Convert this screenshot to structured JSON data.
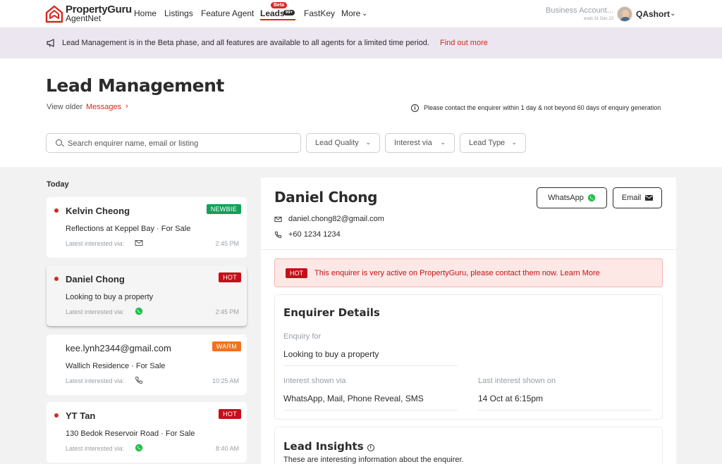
{
  "brand": {
    "name": "PropertyGuru",
    "sub": "AgentNet",
    "color": "#d6281e"
  },
  "nav": {
    "home": "Home",
    "listings": "Listings",
    "feature_agent": "Feature Agent",
    "leads": "Leads",
    "leads_beta": "Beta",
    "leads_count": "99+",
    "fastkey": "FastKey",
    "more": "More"
  },
  "account": {
    "business": "Business Account...",
    "expiry": "ends 31 Dec 23",
    "user": "QAshort"
  },
  "banner": {
    "text": "Lead Management is in the Beta phase, and all features are available to all agents for a limited time period.",
    "link": "Find out more"
  },
  "page": {
    "title": "Lead Management",
    "view_older": "View older",
    "messages_link": "Messages",
    "notice": "Please contact the enquirer within 1 day & not beyond 60 days of enquiry generation"
  },
  "filters": {
    "search_placeholder": "Search enquirer name, email or listing",
    "lead_quality": "Lead Quality",
    "interest_via": "Interest via",
    "lead_type": "Lead Type"
  },
  "list": {
    "group": "Today",
    "via_label": "Latest interested via:",
    "leads": [
      {
        "name": "Kelvin Cheong",
        "badge": "NEWBIE",
        "sub": "Reflections at Keppel Bay  ·  For Sale",
        "via": "mail-icon",
        "time": "2:45 PM",
        "unread": true
      },
      {
        "name": "Daniel Chong",
        "badge": "HOT",
        "sub": "Looking to  buy a property",
        "via": "whatsapp-icon",
        "time": "2:45 PM",
        "unread": true
      },
      {
        "name": "kee.lynh2344@gmail.com",
        "badge": "WARM",
        "sub": "Wallich Residence  ·  For Sale",
        "via": "phone-icon",
        "time": "10:25 AM",
        "unread": false
      },
      {
        "name": "YT Tan",
        "badge": "HOT",
        "sub": "130 Bedok Reservoir Road  ·  For Sale",
        "via": "whatsapp-icon",
        "time": "8:40 AM",
        "unread": true
      }
    ]
  },
  "detail": {
    "name": "Daniel Chong",
    "whatsapp_label": "WhatsApp",
    "email_label": "Email",
    "email": "daniel.chong82@gmail.com",
    "phone": "+60 1234 1234",
    "hot_tag": "HOT",
    "hot_message": "This enquirer is very active on PropertyGuru, please contact them now. Learn More",
    "enquirer_details": {
      "title": "Enquirer Details",
      "enquiry_for_label": "Enquiry for",
      "enquiry_for_value": "Looking to buy a property",
      "interest_via_label": "Interest shown via",
      "interest_via_value": "WhatsApp, Mail, Phone Reveal, SMS",
      "last_interest_label": "Last interest shown on",
      "last_interest_value": "14 Oct at 6:15pm"
    },
    "insights": {
      "title": "Lead Insights",
      "subtitle": "These are interesting information about the enquirer."
    }
  },
  "colors": {
    "accent": "#d6281e",
    "banner_bg": "#ece6f1",
    "hot": "#c4101a",
    "warm": "#f2711c",
    "newbie": "#14a05a",
    "whatsapp": "#25c04b"
  }
}
